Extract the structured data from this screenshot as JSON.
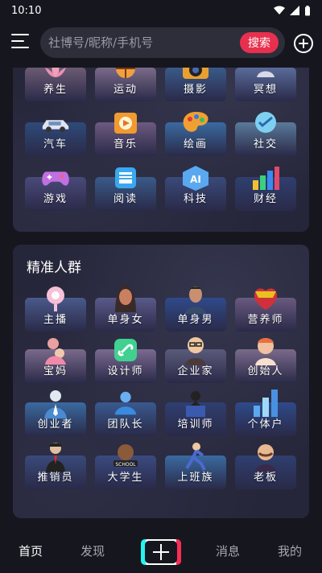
{
  "status_bar": {
    "time": "10:10"
  },
  "search": {
    "placeholder": "社博号/昵称/手机号",
    "button_label": "搜索"
  },
  "interest_section": {
    "tiles": [
      {
        "label": "养生",
        "icon": "lotus-icon",
        "color": "#6b5b73"
      },
      {
        "label": "运动",
        "icon": "sports-icon",
        "color": "#7a6b88"
      },
      {
        "label": "摄影",
        "icon": "camera-icon",
        "color": "#3a5a8a"
      },
      {
        "label": "冥想",
        "icon": "meditation-icon",
        "color": "#5a6b9a"
      },
      {
        "label": "汽车",
        "icon": "car-icon",
        "color": "#2f4a7a"
      },
      {
        "label": "音乐",
        "icon": "music-player-icon",
        "color": "#6d5a80"
      },
      {
        "label": "绘画",
        "icon": "palette-icon",
        "color": "#3a6aa0"
      },
      {
        "label": "社交",
        "icon": "chat-icon",
        "color": "#5a7a9a"
      },
      {
        "label": "游戏",
        "icon": "gamepad-icon",
        "color": "#4a4a7a"
      },
      {
        "label": "阅读",
        "icon": "book-icon",
        "color": "#3a5a8a"
      },
      {
        "label": "科技",
        "icon": "ai-chip-icon",
        "color": "#3a4a7a"
      },
      {
        "label": "财经",
        "icon": "bar-chart-icon",
        "color": "#2f3f6f"
      }
    ]
  },
  "crowd_section": {
    "title": "精准人群",
    "tiles": [
      {
        "label": "主播",
        "icon": "ring-light-icon",
        "color": "#4a5a8a"
      },
      {
        "label": "单身女",
        "icon": "woman-avatar-icon",
        "color": "#5a5a8a"
      },
      {
        "label": "单身男",
        "icon": "man-avatar-icon",
        "color": "#2f4a8a"
      },
      {
        "label": "营养师",
        "icon": "nutrition-icon",
        "color": "#6a5a80"
      },
      {
        "label": "宝妈",
        "icon": "mother-baby-icon",
        "color": "#7a6a8a"
      },
      {
        "label": "设计师",
        "icon": "design-link-icon",
        "color": "#7a6a90"
      },
      {
        "label": "企业家",
        "icon": "businessman-icon",
        "color": "#5a5a7a"
      },
      {
        "label": "创始人",
        "icon": "founder-icon",
        "color": "#7a6a8a"
      },
      {
        "label": "创业者",
        "icon": "entrepreneur-icon",
        "color": "#3a6aa0"
      },
      {
        "label": "团队长",
        "icon": "team-icon",
        "color": "#3a5a90"
      },
      {
        "label": "培训师",
        "icon": "trainer-icon",
        "color": "#2f3f70"
      },
      {
        "label": "个体户",
        "icon": "store-chart-icon",
        "color": "#2f4a8a"
      },
      {
        "label": "推销员",
        "icon": "salesman-icon",
        "color": "#3a4a7a"
      },
      {
        "label": "大学生",
        "icon": "school-badge-icon",
        "color": "#3a4a80"
      },
      {
        "label": "上班族",
        "icon": "office-worker-icon",
        "color": "#3a6aa0"
      },
      {
        "label": "老板",
        "icon": "boss-icon",
        "color": "#2f3f6f"
      }
    ]
  },
  "bottom_nav": {
    "home": "首页",
    "discover": "发现",
    "messages": "消息",
    "mine": "我的"
  }
}
